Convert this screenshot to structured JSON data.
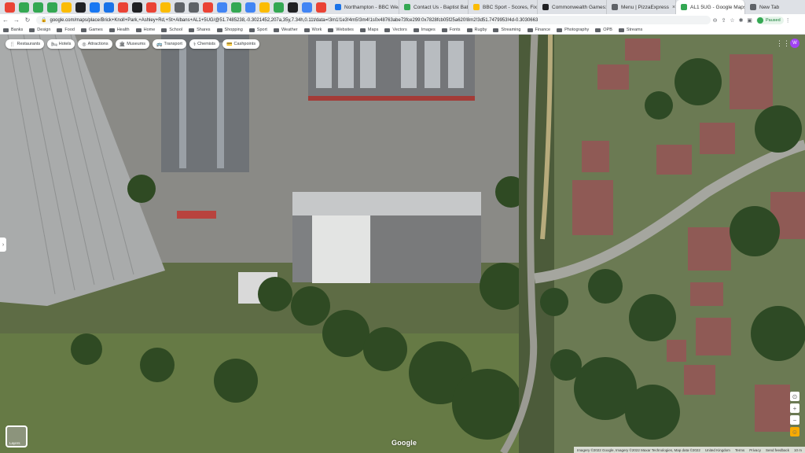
{
  "browser": {
    "pinned_tabs": [
      {
        "icon": "shield-icon",
        "color": "#ea4335"
      },
      {
        "icon": "shield-icon",
        "color": "#34a853"
      },
      {
        "icon": "shield-icon",
        "color": "#34a853"
      },
      {
        "icon": "shield-icon",
        "color": "#34a853"
      },
      {
        "icon": "coin-icon",
        "color": "#fbbc04"
      },
      {
        "icon": "dot-icon",
        "color": "#202124"
      },
      {
        "icon": "facebook-icon",
        "color": "#1877f2"
      },
      {
        "icon": "drive-icon",
        "color": "#1a73e8"
      },
      {
        "icon": "pencil-icon",
        "color": "#ea4335"
      },
      {
        "icon": "square-icon",
        "color": "#202124"
      },
      {
        "icon": "play-icon",
        "color": "#ea4335"
      },
      {
        "icon": "circle-icon",
        "color": "#fbbc04"
      },
      {
        "icon": "dash-icon",
        "color": "#5f6368"
      },
      {
        "icon": "ghost-icon",
        "color": "#5f6368"
      },
      {
        "icon": "star-icon",
        "color": "#ea4335"
      },
      {
        "icon": "cloud-icon",
        "color": "#4285f4"
      },
      {
        "icon": "pin-icon",
        "color": "#34a853"
      },
      {
        "icon": "cloud-icon",
        "color": "#4285f4"
      },
      {
        "icon": "flag-icon",
        "color": "#fbbc04"
      },
      {
        "icon": "shield-icon",
        "color": "#34a853"
      },
      {
        "icon": "tv-icon",
        "color": "#202124"
      },
      {
        "icon": "book-icon",
        "color": "#4285f4"
      },
      {
        "icon": "ticket-icon",
        "color": "#ea4335"
      }
    ],
    "tabs": [
      {
        "title": "Northampton - BBC Weath",
        "color": "#1a73e8",
        "active": false
      },
      {
        "title": "Contact Us - Baptist Bath",
        "color": "#34a853",
        "active": false
      },
      {
        "title": "BBC Sport - Scores, Fixtur",
        "color": "#fbbc04",
        "active": false
      },
      {
        "title": "Commonwealth Games: Bi",
        "color": "#202124",
        "active": false
      },
      {
        "title": "Menu | PizzaExpress",
        "color": "#5f6368",
        "active": false
      },
      {
        "title": "AL1 5UG - Google Maps",
        "color": "#34a853",
        "active": true
      },
      {
        "title": "New Tab",
        "color": "#5f6368",
        "active": false
      }
    ],
    "new_tab_symbol": "+",
    "url": "google.com/maps/place/Brick+Knoll+Park,+Ashley+Rd,+St+Albans+AL1+5UG/@51.7485238,-0.3021452,207a,35y,7.34h,0.11t/data=!3m1!1e3!4m5!3m4!1s0x48763abe73fce299:0x7828fcb05f25a620!8m2!3d51.7479953!4d-0.3030663",
    "profile_label": "Paused",
    "bookmarks": [
      "Banks",
      "Design",
      "Food",
      "Games",
      "Health",
      "Home",
      "School",
      "Shares",
      "Shopping",
      "Sport",
      "Weather",
      "Work",
      "Websites",
      "Maps",
      "Vectors",
      "Images",
      "Fonts",
      "Rugby",
      "Streaming",
      "Finance",
      "Photography",
      "OPB",
      "Streams"
    ]
  },
  "map": {
    "chips": [
      {
        "icon": "🍴",
        "label": "Restaurants"
      },
      {
        "icon": "🛏",
        "label": "Hotels"
      },
      {
        "icon": "◎",
        "label": "Attractions"
      },
      {
        "icon": "🏛",
        "label": "Museums"
      },
      {
        "icon": "🚌",
        "label": "Transport"
      },
      {
        "icon": "⚕",
        "label": "Chemists"
      },
      {
        "icon": "💳",
        "label": "Cashpoints"
      }
    ],
    "layers_label": "Layers",
    "logo": "Google",
    "attribution": [
      "Imagery ©2022 Google, Imagery ©2022 Maxar Technologies, Map data ©2022",
      "United Kingdom",
      "Terms",
      "Privacy",
      "Send feedback",
      "10 m"
    ]
  }
}
